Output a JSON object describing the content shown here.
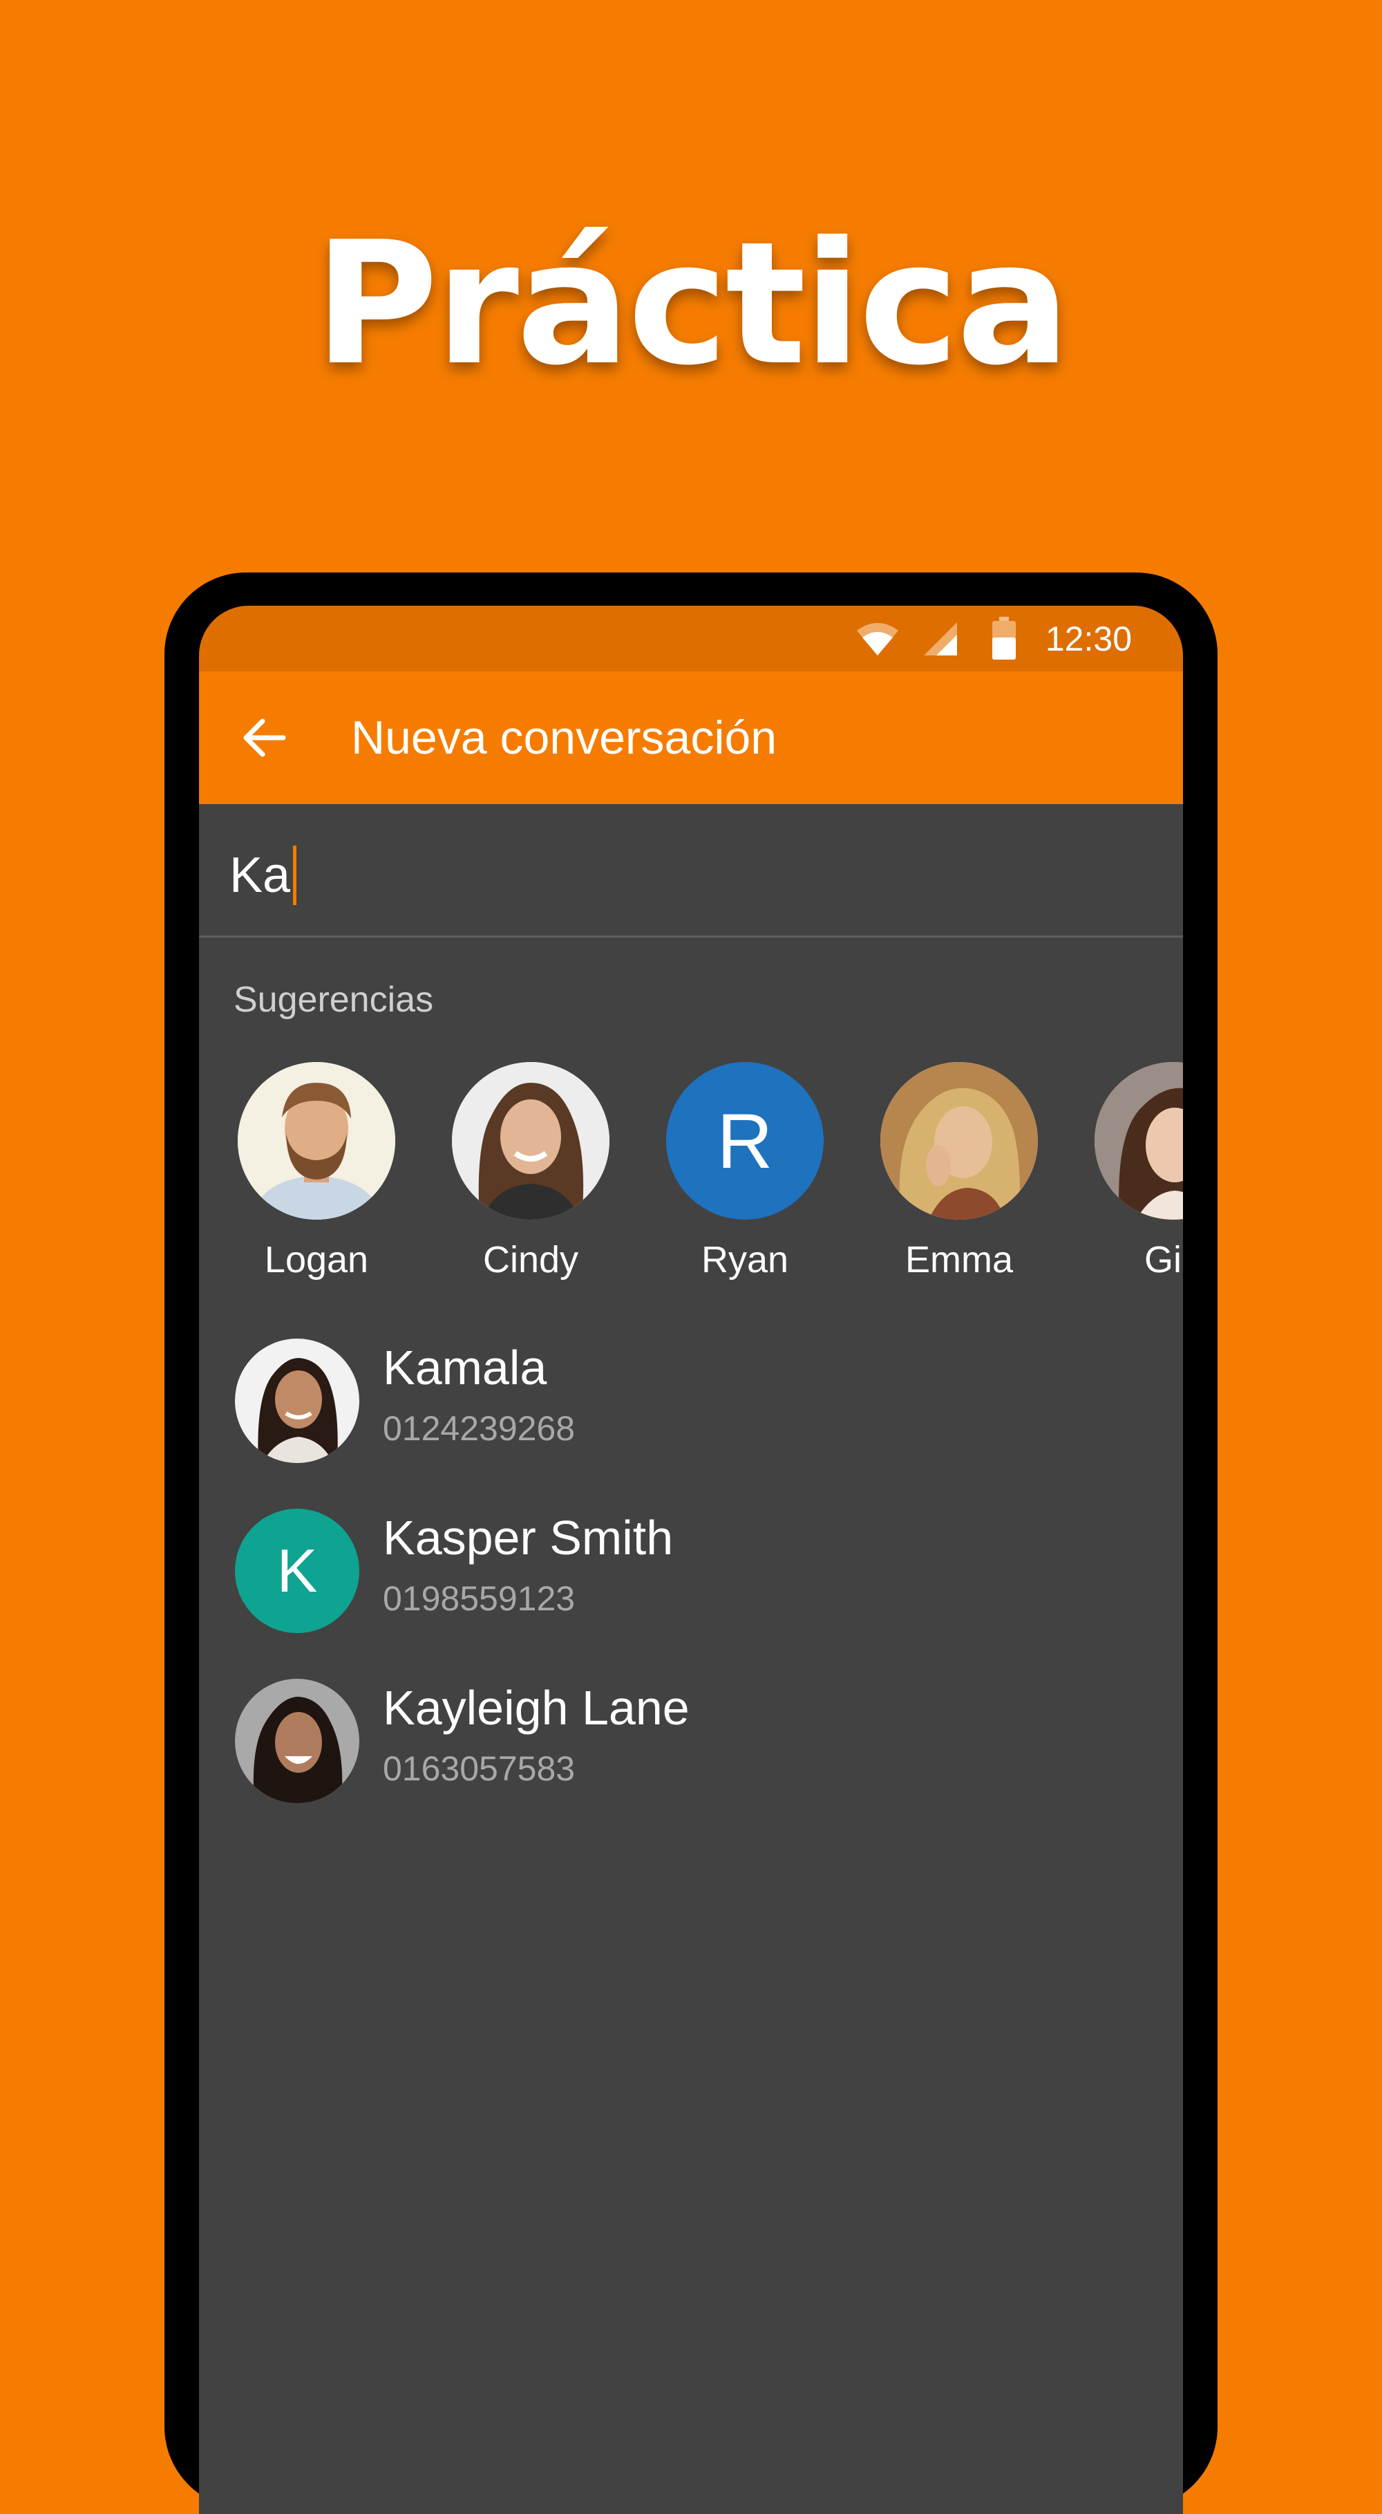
{
  "hero": {
    "title": "Práctica"
  },
  "status_bar": {
    "time": "12:30"
  },
  "app_bar": {
    "title": "Nueva conversación"
  },
  "search": {
    "value": "Ka"
  },
  "suggestions": {
    "label": "Sugerencias",
    "items": [
      {
        "name": "Logan",
        "avatar": "photo"
      },
      {
        "name": "Cindy",
        "avatar": "photo"
      },
      {
        "name": "Ryan",
        "avatar": "letter",
        "letter": "R",
        "color": "#1E72BE"
      },
      {
        "name": "Emma",
        "avatar": "photo"
      },
      {
        "name": "Gin",
        "avatar": "photo"
      }
    ]
  },
  "contacts": [
    {
      "name": "Kamala",
      "phone": "0124239268",
      "avatar": "photo"
    },
    {
      "name": "Kasper Smith",
      "phone": "0198559123",
      "avatar": "letter",
      "letter": "K",
      "color": "#0FA391"
    },
    {
      "name": "Kayleigh Lane",
      "phone": "0163057583",
      "avatar": "photo"
    }
  ],
  "colors": {
    "brand_orange": "#F57C00",
    "status_bar": "#DE6E00",
    "screen_background": "#424242"
  }
}
